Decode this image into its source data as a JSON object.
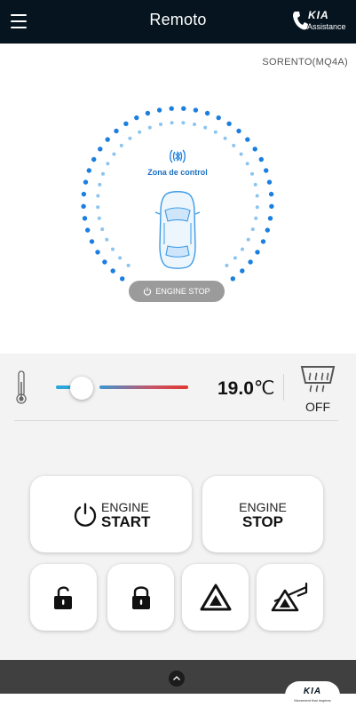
{
  "header": {
    "title": "Remoto",
    "menu_icon": "hamburger-menu-icon",
    "assistance": {
      "brand": "KIA",
      "label": "Assistance",
      "icon": "phone-icon"
    }
  },
  "vehicle": {
    "model": "SORENTO(MQ4A)"
  },
  "control_zone": {
    "label": "Zona de control",
    "bluetooth_icon": "bluetooth-signal-icon",
    "status": "ENGINE STOP",
    "status_icon": "power-icon"
  },
  "climate": {
    "temperature_value": "19.0",
    "temperature_unit": "℃",
    "slider_level_percent": 15,
    "thermometer_icon": "thermometer-icon",
    "defrost_icon": "rear-defrost-icon",
    "defrost_state": "OFF"
  },
  "actions": {
    "engine_start": {
      "line1": "ENGINE",
      "line2": "START",
      "icon": "power-icon"
    },
    "engine_stop": {
      "line1": "ENGINE",
      "line2": "STOP"
    },
    "unlock_icon": "unlock-icon",
    "lock_icon": "lock-icon",
    "hazard_icon": "hazard-icon",
    "horn_hazard_icon": "horn-icon"
  },
  "footer": {
    "expand_icon": "chevron-up-icon",
    "logo_brand": "KIA",
    "logo_slogan": "Movement that inspires"
  },
  "colors": {
    "header_bg": "#06141f",
    "zone_blue": "#1b7fe0",
    "slider_cold": "#2aa6dc",
    "slider_hot": "#e0382e",
    "pill_grey": "#9b9b9b"
  }
}
